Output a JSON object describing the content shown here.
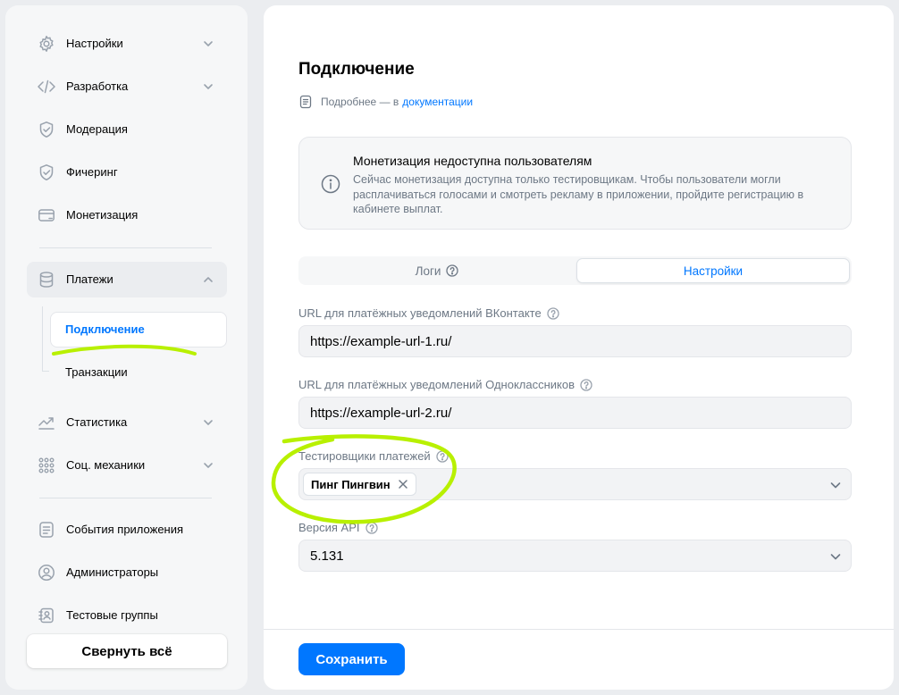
{
  "sidebar": {
    "items": [
      {
        "label": "Настройки",
        "icon": "gear-icon"
      },
      {
        "label": "Разработка",
        "icon": "code-icon"
      },
      {
        "label": "Модерация",
        "icon": "shield-icon"
      },
      {
        "label": "Фичеринг",
        "icon": "shield-icon"
      },
      {
        "label": "Монетизация",
        "icon": "card-icon"
      },
      {
        "label": "Платежи",
        "icon": "database-icon"
      },
      {
        "label": "Статистика",
        "icon": "stats-icon"
      },
      {
        "label": "Соц. механики",
        "icon": "dots-icon"
      },
      {
        "label": "События приложения",
        "icon": "document-icon"
      },
      {
        "label": "Администраторы",
        "icon": "user-icon"
      },
      {
        "label": "Тестовые группы",
        "icon": "contacts-icon"
      }
    ],
    "sub_items": [
      {
        "label": "Подключение"
      },
      {
        "label": "Транзакции"
      }
    ],
    "collapse_label": "Свернуть всё"
  },
  "main": {
    "title": "Подключение",
    "doc_prefix": "Подробнее — в",
    "doc_link": "документации",
    "notice": {
      "title": "Монетизация недоступна пользователям",
      "text": "Сейчас монетизация доступна только тестировщикам. Чтобы пользователи могли расплачиваться голосами и смотреть рекламу в приложении, пройдите регистрацию в кабинете выплат."
    },
    "tabs": [
      {
        "label": "Логи"
      },
      {
        "label": "Настройки"
      }
    ],
    "fields": {
      "vk_url_label": "URL для платёжных уведомлений ВКонтакте",
      "vk_url_value": "https://example-url-1.ru/",
      "ok_url_label": "URL для платёжных уведомлений Одноклассников",
      "ok_url_value": "https://example-url-2.ru/",
      "testers_label": "Тестировщики платежей",
      "tester_chip": "Пинг Пингвин",
      "api_label": "Версия API",
      "api_value": "5.131"
    },
    "save_label": "Сохранить"
  },
  "colors": {
    "accent": "#0077ff",
    "highlight": "#b8f000"
  }
}
